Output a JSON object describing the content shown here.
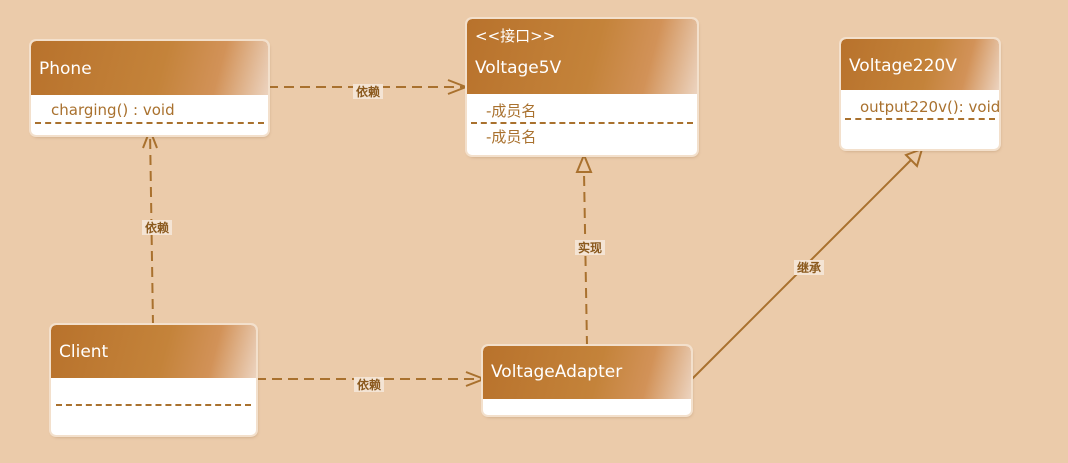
{
  "diagram": {
    "classes": {
      "phone": {
        "name": "Phone",
        "members": [
          "charging() : void"
        ]
      },
      "voltage5v": {
        "stereotype": "<<接口>>",
        "name": "Voltage5V",
        "members": [
          "-成员名",
          "-成员名"
        ]
      },
      "voltage220v": {
        "name": "Voltage220V",
        "members": [
          "output220v(): void"
        ]
      },
      "client": {
        "name": "Client",
        "members": []
      },
      "voltage_adapter": {
        "name": "VoltageAdapter",
        "members": []
      }
    },
    "relations": [
      {
        "from": "Phone",
        "to": "Voltage5V",
        "label": "依赖",
        "kind": "dependency"
      },
      {
        "from": "Client",
        "to": "Phone",
        "label": "依赖",
        "kind": "dependency"
      },
      {
        "from": "Client",
        "to": "VoltageAdapter",
        "label": "依赖",
        "kind": "dependency"
      },
      {
        "from": "VoltageAdapter",
        "to": "Voltage5V",
        "label": "实现",
        "kind": "realization"
      },
      {
        "from": "VoltageAdapter",
        "to": "Voltage220V",
        "label": "继承",
        "kind": "inheritance"
      }
    ],
    "colors": {
      "background": "#ebcbaa",
      "line": "#a9712e",
      "header": "#c4833a",
      "label": "#8b5a1e"
    }
  }
}
